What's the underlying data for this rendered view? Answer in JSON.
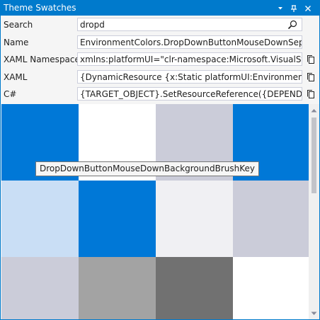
{
  "window": {
    "title": "Theme Swatches"
  },
  "search": {
    "label": "Search",
    "value": "dropd"
  },
  "fields": {
    "name": {
      "label": "Name",
      "value": "EnvironmentColors.DropDownButtonMouseDownSeparator"
    },
    "xaml_namespace": {
      "label": "XAML Namespace",
      "value": "xmlns:platformUI=\"clr-namespace:Microsoft.VisualStudio.P"
    },
    "xaml": {
      "label": "XAML",
      "value": "{DynamicResource {x:Static platformUI:EnvironmentColors.D"
    },
    "csharp": {
      "label": "C#",
      "value": "{TARGET_OBJECT}.SetResourceReference({DEPENDENCY_PR"
    }
  },
  "swatch_colors": [
    "#0078d7",
    "#ffffff",
    "#cbccd9",
    "#0078d7",
    "#c9def5",
    "#0078d7",
    "#f0f0f3",
    "#cbccd9",
    "#cbccd9",
    "#a3a3a3",
    "#717171",
    "#ffffff"
  ],
  "tooltip": "DropDownButtonMouseDownBackgroundBrushKey",
  "colors": {
    "accent": "#007acc",
    "field_border": "#cccedb",
    "scroll_thumb": "#c2c3c9"
  },
  "icons": {
    "title": [
      "chevron-down-icon",
      "pin-icon",
      "close-icon"
    ],
    "search": "search-icon",
    "copy": "copy-icon",
    "scroll": [
      "scroll-up-icon",
      "scroll-down-icon"
    ]
  }
}
